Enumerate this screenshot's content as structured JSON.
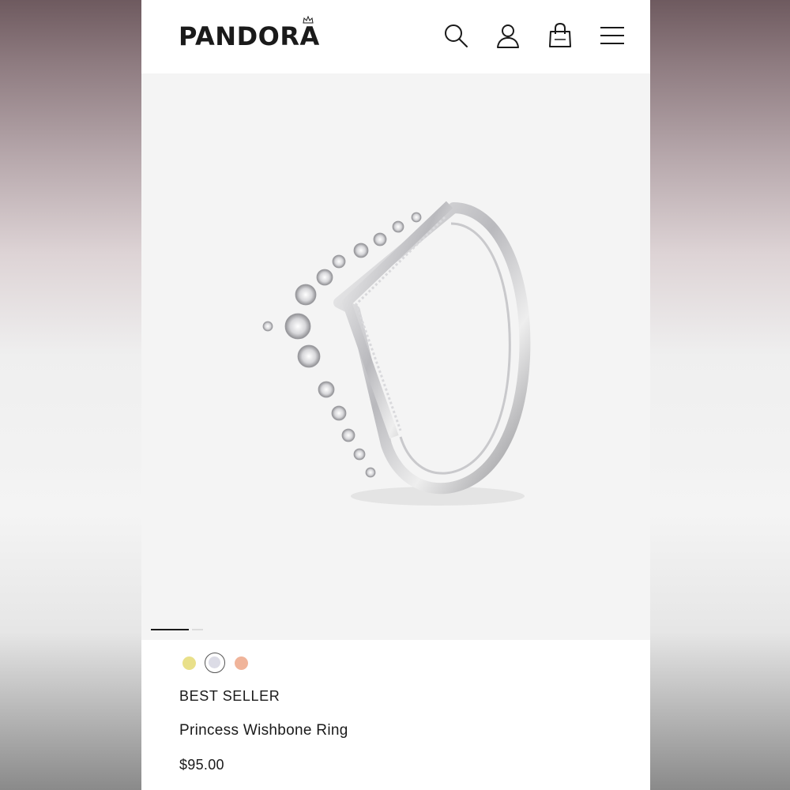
{
  "header": {
    "brand": "PANDORA",
    "icons": [
      "search-icon",
      "account-icon",
      "bag-icon",
      "menu-icon"
    ]
  },
  "gallery": {
    "current_slide": 1,
    "slides_visible": 2
  },
  "product": {
    "badge": "BEST SELLER",
    "name": "Princess Wishbone Ring",
    "price": "$95.00",
    "swatches": [
      {
        "name": "gold",
        "color": "#e9e08a",
        "selected": false
      },
      {
        "name": "silver",
        "color": "#dcdce6",
        "selected": true
      },
      {
        "name": "rose",
        "color": "#f0b49a",
        "selected": false
      }
    ]
  },
  "colors": {
    "text": "#1a1a1a",
    "gallery_bg": "#f4f4f4",
    "page_bg": "#ffffff"
  }
}
